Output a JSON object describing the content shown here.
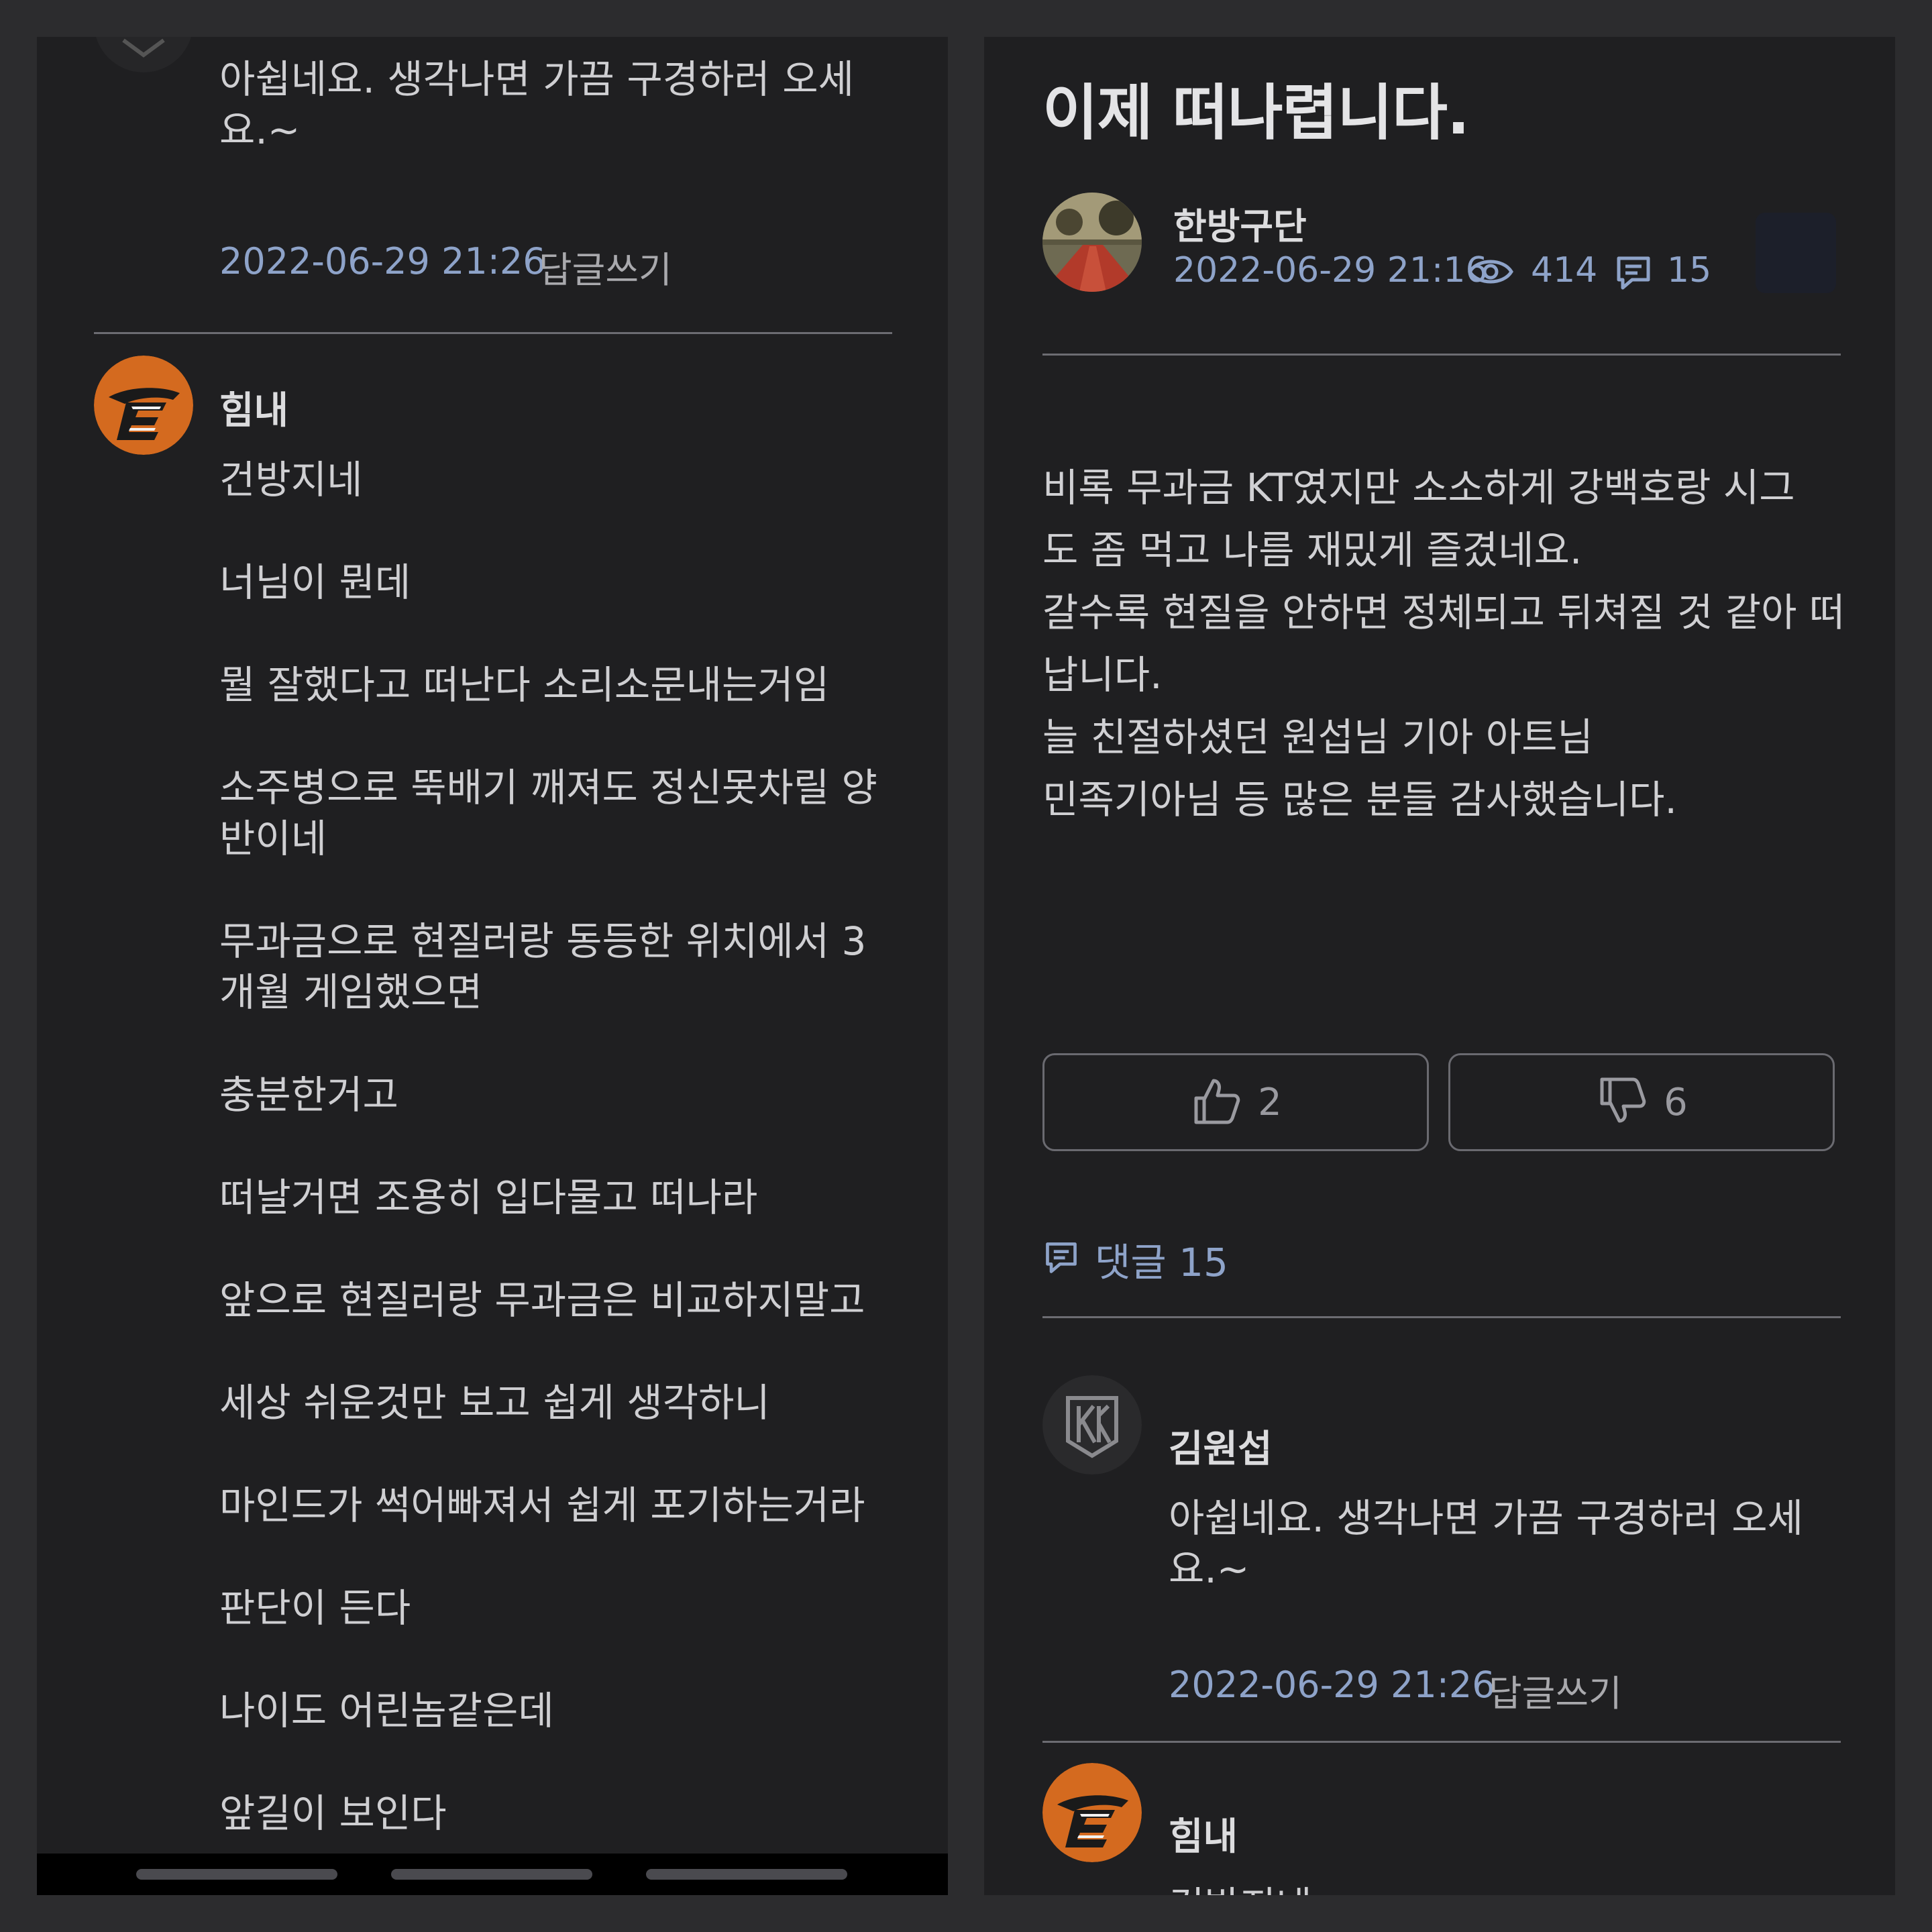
{
  "left": {
    "first_comment": {
      "text_line1": "아쉽네요. 생각나면 가끔 구경하러 오세",
      "text_line2": "요.~",
      "date": "2022-06-29 21:26",
      "reply": "답글쓰기"
    },
    "second_comment": {
      "author": "힘내",
      "lines": [
        "건방지네",
        "너님이 뭔데",
        "뭘 잘했다고 떠난다 소리소문내는거임",
        "소주병으로 뚝배기 깨져도 정신못차릴 양",
        "반이네",
        "무과금으로 현질러랑 동등한 위치에서 3",
        "개월 게임했으면",
        "충분한거고",
        "떠날거면 조용히 입다물고 떠나라",
        "앞으로 현질러랑 무과금은 비교하지말고",
        "세상 쉬운것만 보고 쉽게 생각하니",
        "마인드가 썩어빠져서 쉽게 포기하는거라",
        "판단이 든다",
        "나이도 어린놈같은데",
        "앞길이 보인다"
      ]
    }
  },
  "right": {
    "title": "이제 떠나렵니다.",
    "author": "한방구단",
    "date": "2022-06-29 21:16",
    "views": "414",
    "comment_count": "15",
    "body": [
      " 비록 무과금 KT였지만 소소하게 강백호랑 시그",
      "도 좀 먹고 나름 재밌게 즐겼네요.",
      "갈수록 현질을 안하면 정체되고 뒤쳐질 것 같아 떠",
      "납니다.",
      "늘 친절하셨던 원섭님 기아 아트님",
      "민족기아님 등 많은 분들 감사했습니다."
    ],
    "likes": "2",
    "dislikes": "6",
    "comments_label": "댓글 15",
    "comment1": {
      "author": "김원섭",
      "text_line1": "아쉽네요. 생각나면 가끔 구경하러 오세",
      "text_line2": "요.~",
      "date": "2022-06-29 21:26",
      "reply": "답글쓰기"
    },
    "comment2": {
      "author": "힘내",
      "text": "건방지네"
    }
  },
  "colors": {
    "background": "#2c2c2e",
    "panel": "#1f1f21",
    "accent_blue": "#8ea3c9",
    "text": "#cfcfd2",
    "eagles_orange": "#d46a1f"
  },
  "icons": [
    "eagles-logo-icon",
    "kiwoom-logo-icon",
    "eye-icon",
    "comment-icon",
    "thumbs-up-icon",
    "thumbs-down-icon"
  ]
}
